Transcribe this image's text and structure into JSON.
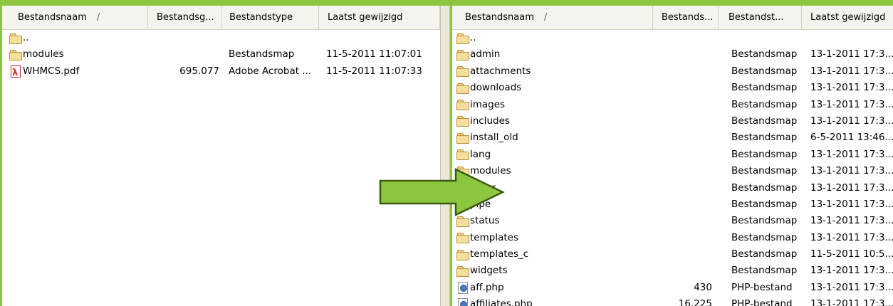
{
  "colors": {
    "accent": "#8cc63f"
  },
  "left_pane": {
    "headers": [
      "Bestandsnaam",
      "Bestandsg...",
      "Bestandstype",
      "Laatst gewijzigd"
    ],
    "sort_indicator": "/",
    "rows": [
      {
        "name": "..",
        "size": "",
        "type": "",
        "modified": "",
        "icon": "folder-icon"
      },
      {
        "name": "modules",
        "size": "",
        "type": "Bestandsmap",
        "modified": "11-5-2011 11:07:01",
        "icon": "folder-icon"
      },
      {
        "name": "WHMCS.pdf",
        "size": "695.077",
        "type": "Adobe Acrobat ...",
        "modified": "11-5-2011 11:07:33",
        "icon": "pdf-icon"
      }
    ]
  },
  "right_pane": {
    "headers": [
      "Bestandsnaam",
      "Bestands...",
      "Bestandst...",
      "Laatst gewijzigd"
    ],
    "sort_indicator": "/",
    "rows": [
      {
        "name": "..",
        "size": "",
        "type": "",
        "modified": "",
        "icon": "folder-icon"
      },
      {
        "name": "admin",
        "size": "",
        "type": "Bestandsmap",
        "modified": "13-1-2011 17:3...",
        "icon": "folder-icon"
      },
      {
        "name": "attachments",
        "size": "",
        "type": "Bestandsmap",
        "modified": "13-1-2011 17:3...",
        "icon": "folder-icon"
      },
      {
        "name": "downloads",
        "size": "",
        "type": "Bestandsmap",
        "modified": "13-1-2011 17:3...",
        "icon": "folder-icon"
      },
      {
        "name": "images",
        "size": "",
        "type": "Bestandsmap",
        "modified": "13-1-2011 17:3...",
        "icon": "folder-icon"
      },
      {
        "name": "includes",
        "size": "",
        "type": "Bestandsmap",
        "modified": "13-1-2011 17:3...",
        "icon": "folder-icon"
      },
      {
        "name": "install_old",
        "size": "",
        "type": "Bestandsmap",
        "modified": "6-5-2011 13:46...",
        "icon": "folder-icon"
      },
      {
        "name": "lang",
        "size": "",
        "type": "Bestandsmap",
        "modified": "13-1-2011 17:3...",
        "icon": "folder-icon"
      },
      {
        "name": "modules",
        "size": "",
        "type": "Bestandsmap",
        "modified": "13-1-2011 17:3...",
        "icon": "folder-icon"
      },
      {
        "name": "order",
        "size": "",
        "type": "Bestandsmap",
        "modified": "13-1-2011 17:3...",
        "icon": "folder-icon"
      },
      {
        "name": "pipe",
        "size": "",
        "type": "Bestandsmap",
        "modified": "13-1-2011 17:3...",
        "icon": "folder-icon"
      },
      {
        "name": "status",
        "size": "",
        "type": "Bestandsmap",
        "modified": "13-1-2011 17:3...",
        "icon": "folder-icon"
      },
      {
        "name": "templates",
        "size": "",
        "type": "Bestandsmap",
        "modified": "13-1-2011 17:3...",
        "icon": "folder-icon"
      },
      {
        "name": "templates_c",
        "size": "",
        "type": "Bestandsmap",
        "modified": "11-5-2011 10:5...",
        "icon": "folder-icon"
      },
      {
        "name": "widgets",
        "size": "",
        "type": "Bestandsmap",
        "modified": "13-1-2011 17:3...",
        "icon": "folder-icon"
      },
      {
        "name": "aff.php",
        "size": "430",
        "type": "PHP-bestand",
        "modified": "13-1-2011 17:3...",
        "icon": "php-icon"
      },
      {
        "name": "affiliates.php",
        "size": "16.225",
        "type": "PHP-bestand",
        "modified": "13-1-2011 17:3...",
        "icon": "php-icon"
      }
    ]
  }
}
